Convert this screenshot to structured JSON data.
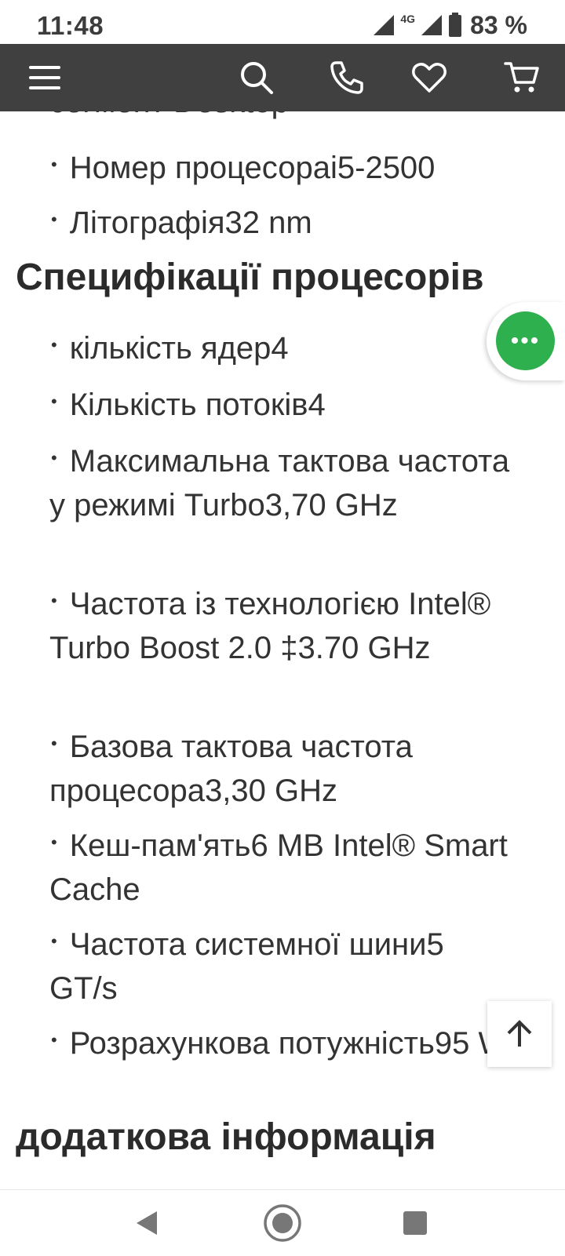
{
  "status_bar": {
    "time": "11:48",
    "network": "4G",
    "battery": "83 %"
  },
  "nav": {
    "icons": [
      "menu-icon",
      "search-icon",
      "phone-icon",
      "heart-icon",
      "cart-icon"
    ]
  },
  "content": {
    "clipped_line": "сегмент Desktop",
    "top_items": [
      "Номер процесораi5-2500",
      "Літографія32 nm"
    ],
    "spec_heading": "Специфікації процесорів",
    "spec_items": [
      "кількість ядер4",
      "Кількість потоків4",
      "Максимальна тактова частота у режимі Turbo3,70 GHz",
      "Частота із технологією Intel® Turbo Boost 2.0 ‡3.70 GHz",
      "Базова тактова частота процесора3,30 GHz",
      "Кеш-пам'ять6 MB Intel® Smart Cache",
      "Частота системної шини5 GT/s",
      "Розрахункова потужність95 W"
    ],
    "extra_heading": "додаткова інформація"
  },
  "chat_button": {
    "label": "•••"
  },
  "colors": {
    "nav_bg": "#404040",
    "chat_green": "#2fb04f",
    "text": "#333333"
  }
}
